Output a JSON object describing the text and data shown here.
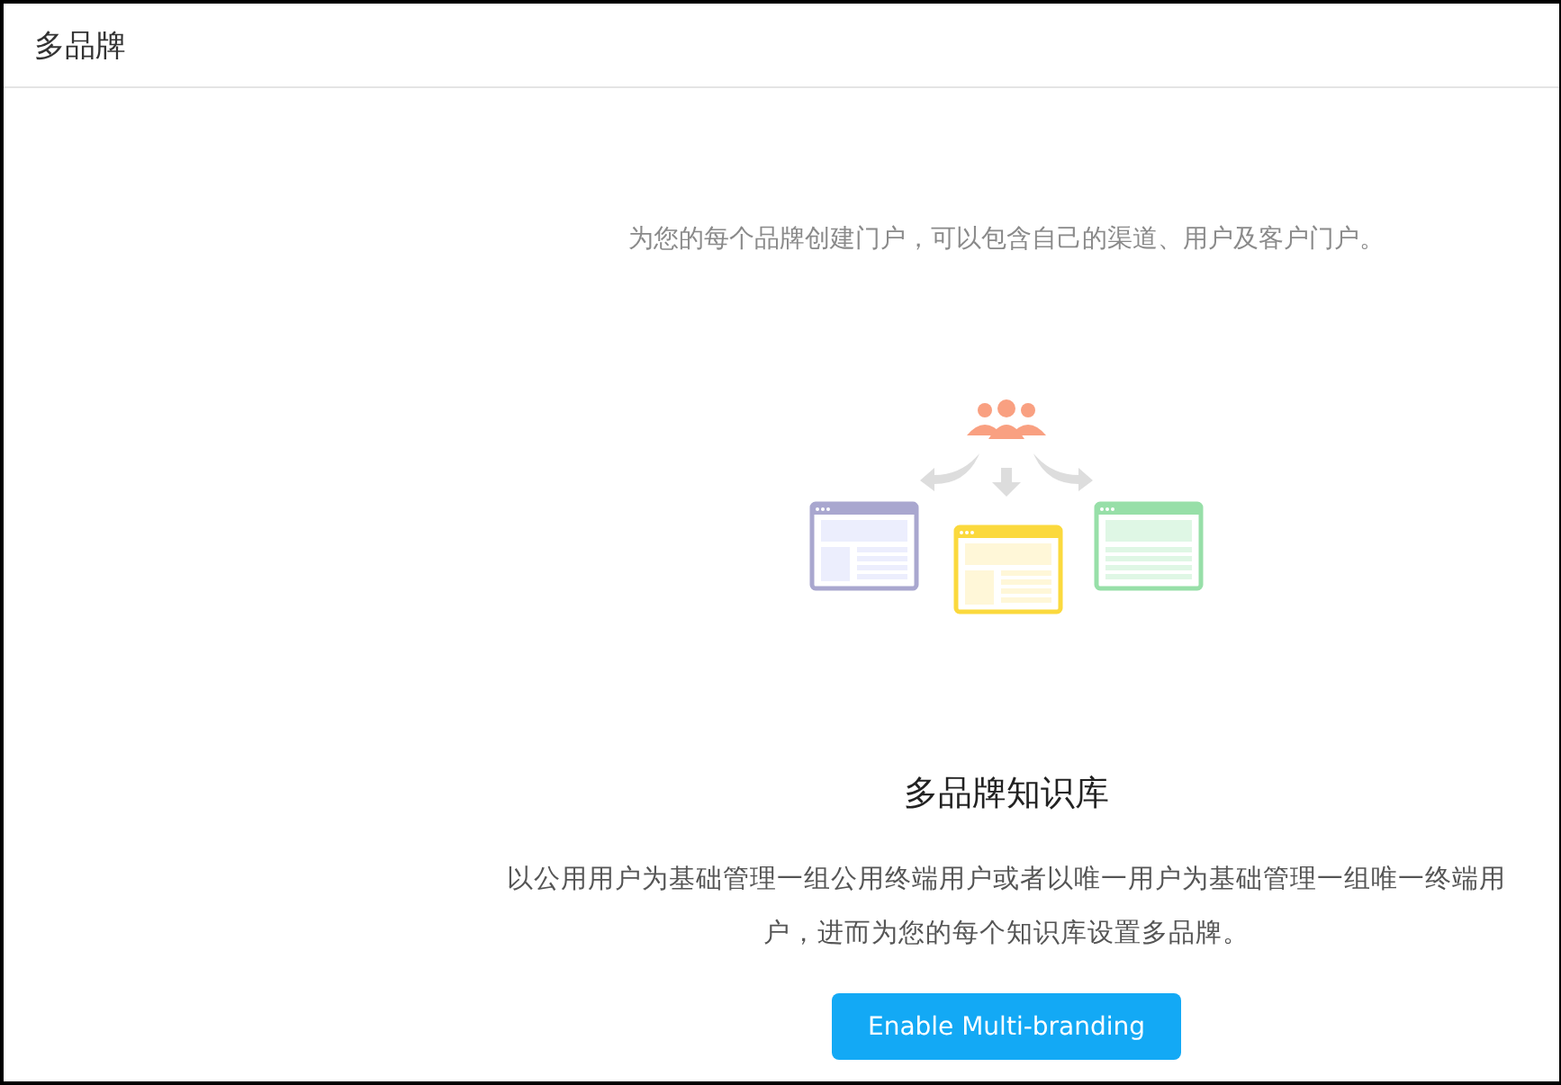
{
  "header": {
    "title": "多品牌"
  },
  "intro": "为您的每个品牌创建门户，可以包含自己的渠道、用户及客户门户。",
  "feature": {
    "title": "多品牌知识库",
    "description": "以公用用户为基础管理一组公用终端用户或者以唯一用户为基础管理一组唯一终端用户，进而为您的每个知识库设置多品牌。"
  },
  "buttons": [
    {
      "label": "Enable Multi-branding",
      "kind": "primary"
    }
  ]
}
